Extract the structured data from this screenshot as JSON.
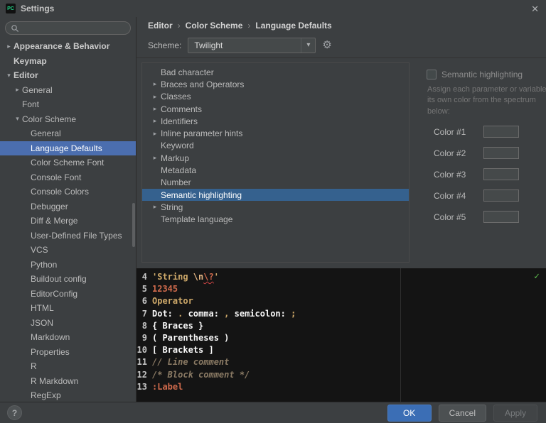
{
  "titlebar": {
    "title": "Settings",
    "app_icon_text": "PC"
  },
  "search": {
    "value": ""
  },
  "icons": {
    "chevron_right": "▸",
    "chevron_down": "▾",
    "breadcrumb_sep": "›",
    "close": "✕",
    "gear": "⚙",
    "check": "✓",
    "help": "?",
    "combo_arrow": "▾"
  },
  "colors": {
    "sidebar_selection": "#4b6eaf",
    "tree_selection": "#35618e",
    "ok_button": "#3b6eb5",
    "preview_background": "#141414",
    "success_check": "#5dbb4d"
  },
  "sidebar": {
    "items": [
      {
        "label": "Appearance & Behavior",
        "indent": 0,
        "arrow": "right",
        "bold": true
      },
      {
        "label": "Keymap",
        "indent": 0,
        "bold": true
      },
      {
        "label": "Editor",
        "indent": 0,
        "arrow": "down",
        "bold": true
      },
      {
        "label": "General",
        "indent": 1,
        "arrow": "right"
      },
      {
        "label": "Font",
        "indent": 1
      },
      {
        "label": "Color Scheme",
        "indent": 1,
        "arrow": "down"
      },
      {
        "label": "General",
        "indent": 2
      },
      {
        "label": "Language Defaults",
        "indent": 2,
        "selected": true
      },
      {
        "label": "Color Scheme Font",
        "indent": 2
      },
      {
        "label": "Console Font",
        "indent": 2
      },
      {
        "label": "Console Colors",
        "indent": 2
      },
      {
        "label": "Debugger",
        "indent": 2
      },
      {
        "label": "Diff & Merge",
        "indent": 2
      },
      {
        "label": "User-Defined File Types",
        "indent": 2
      },
      {
        "label": "VCS",
        "indent": 2
      },
      {
        "label": "Python",
        "indent": 2
      },
      {
        "label": "Buildout config",
        "indent": 2
      },
      {
        "label": "EditorConfig",
        "indent": 2
      },
      {
        "label": "HTML",
        "indent": 2
      },
      {
        "label": "JSON",
        "indent": 2
      },
      {
        "label": "Markdown",
        "indent": 2
      },
      {
        "label": "Properties",
        "indent": 2
      },
      {
        "label": "R",
        "indent": 2
      },
      {
        "label": "R Markdown",
        "indent": 2
      },
      {
        "label": "RegExp",
        "indent": 2
      }
    ]
  },
  "breadcrumb": {
    "items": [
      "Editor",
      "Color Scheme",
      "Language Defaults"
    ]
  },
  "scheme": {
    "label": "Scheme:",
    "value": "Twilight"
  },
  "options_tree": {
    "items": [
      {
        "label": "Bad character"
      },
      {
        "label": "Braces and Operators",
        "expandable": true
      },
      {
        "label": "Classes",
        "expandable": true
      },
      {
        "label": "Comments",
        "expandable": true
      },
      {
        "label": "Identifiers",
        "expandable": true
      },
      {
        "label": "Inline parameter hints",
        "expandable": true
      },
      {
        "label": "Keyword"
      },
      {
        "label": "Markup",
        "expandable": true
      },
      {
        "label": "Metadata"
      },
      {
        "label": "Number"
      },
      {
        "label": "Semantic highlighting",
        "selected": true
      },
      {
        "label": "String",
        "expandable": true
      },
      {
        "label": "Template language"
      }
    ]
  },
  "detail": {
    "checkbox_label": "Semantic highlighting",
    "description": "Assign each parameter or variable its own color from the spectrum below:",
    "colors": [
      {
        "label": "Color #1"
      },
      {
        "label": "Color #2"
      },
      {
        "label": "Color #3"
      },
      {
        "label": "Color #4"
      },
      {
        "label": "Color #5"
      }
    ]
  },
  "preview": {
    "lines": [
      {
        "num": "4",
        "segments": [
          {
            "t": "'String ",
            "c": "#CDA869"
          },
          {
            "t": "\\n",
            "c": "#E3B583"
          },
          {
            "t": "\\?",
            "c": "#CF6A4C",
            "error": true
          },
          {
            "t": "'",
            "c": "#CDA869"
          }
        ]
      },
      {
        "num": "5",
        "segments": [
          {
            "t": "12345",
            "c": "#CF6A4C"
          }
        ]
      },
      {
        "num": "6",
        "segments": [
          {
            "t": "Operator",
            "c": "#CDA869"
          }
        ]
      },
      {
        "num": "7",
        "segments": [
          {
            "t": "Dot: ",
            "c": "#F8F8F8"
          },
          {
            "t": ".",
            "c": "#CDA869"
          },
          {
            "t": " comma: ",
            "c": "#F8F8F8"
          },
          {
            "t": ",",
            "c": "#CDA869"
          },
          {
            "t": " semicolon: ",
            "c": "#F8F8F8"
          },
          {
            "t": ";",
            "c": "#CDA869"
          }
        ]
      },
      {
        "num": "8",
        "segments": [
          {
            "t": "{ Braces }",
            "c": "#F8F8F8"
          }
        ]
      },
      {
        "num": "9",
        "segments": [
          {
            "t": "( Parentheses )",
            "c": "#F8F8F8"
          }
        ]
      },
      {
        "num": "10",
        "segments": [
          {
            "t": "[ Brackets ]",
            "c": "#F8F8F8"
          }
        ]
      },
      {
        "num": "11",
        "segments": [
          {
            "t": "// Line comment",
            "c": "#8A7A64",
            "italic": true
          }
        ]
      },
      {
        "num": "12",
        "segments": [
          {
            "t": "/* Block comment */",
            "c": "#8A7A64",
            "italic": true
          }
        ]
      },
      {
        "num": "13",
        "segments": [
          {
            "t": ":Label",
            "c": "#CF6A4C"
          }
        ]
      }
    ]
  },
  "footer": {
    "ok": "OK",
    "cancel": "Cancel",
    "apply": "Apply"
  }
}
